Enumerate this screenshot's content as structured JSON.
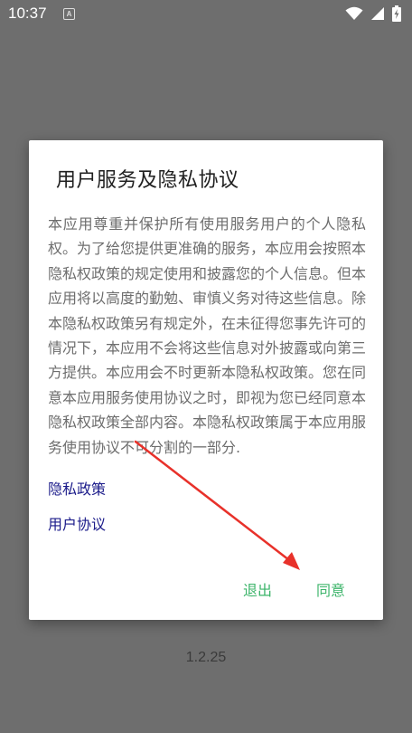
{
  "status_bar": {
    "time": "10:37",
    "notification_glyph": "A",
    "icons": [
      "wifi-icon",
      "signal-icon",
      "battery-charging-icon"
    ]
  },
  "dialog": {
    "title": "用户服务及隐私协议",
    "body": "本应用尊重并保护所有使用服务用户的个人隐私权。为了给您提供更准确的服务，本应用会按照本隐私权政策的规定使用和披露您的个人信息。但本应用将以高度的勤勉、审慎义务对待这些信息。除本隐私权政策另有规定外，在未征得您事先许可的情况下，本应用不会将这些信息对外披露或向第三方提供。本应用会不时更新本隐私权政策。您在同意本应用服务使用协议之时，即视为您已经同意本隐私权政策全部内容。本隐私权政策属于本应用服务使用协议不可分割的一部分.",
    "links": {
      "privacy_policy": "隐私政策",
      "user_agreement": "用户协议"
    },
    "buttons": {
      "exit": "退出",
      "agree": "同意"
    }
  },
  "version": "1.2.25",
  "colors": {
    "backdrop": "#6e6e6e",
    "button_green": "#3cb46a",
    "link_navy": "#1b1b8a",
    "annotation_arrow": "#e8312a"
  }
}
